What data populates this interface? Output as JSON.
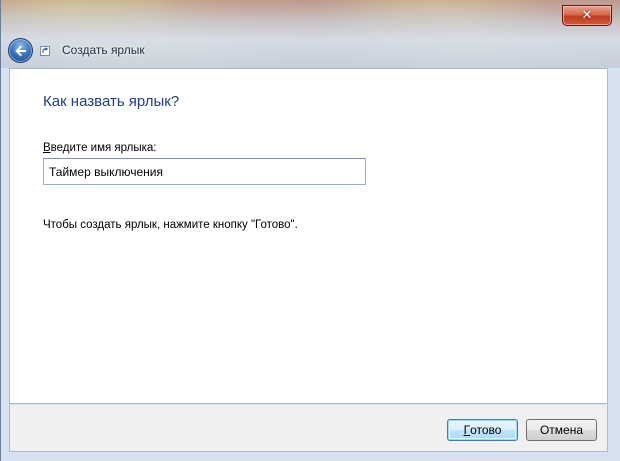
{
  "window": {
    "title": "Создать ярлык"
  },
  "page": {
    "heading": "Как назвать ярлык?",
    "name_label_mnemonic": "В",
    "name_label_rest": "ведите имя ярлыка:",
    "name_value": "Таймер выключения",
    "hint": "Чтобы создать ярлык, нажмите кнопку \"Готово\"."
  },
  "buttons": {
    "finish_mnemonic": "Г",
    "finish_rest": "отово",
    "cancel_label": "Отмена"
  },
  "icons": {
    "close": "close-icon",
    "back": "back-arrow-icon",
    "shortcut": "shortcut-icon"
  },
  "colors": {
    "heading": "#1e3f86",
    "close_button": "#c23d1f",
    "default_button_border": "#3c7fb1"
  }
}
